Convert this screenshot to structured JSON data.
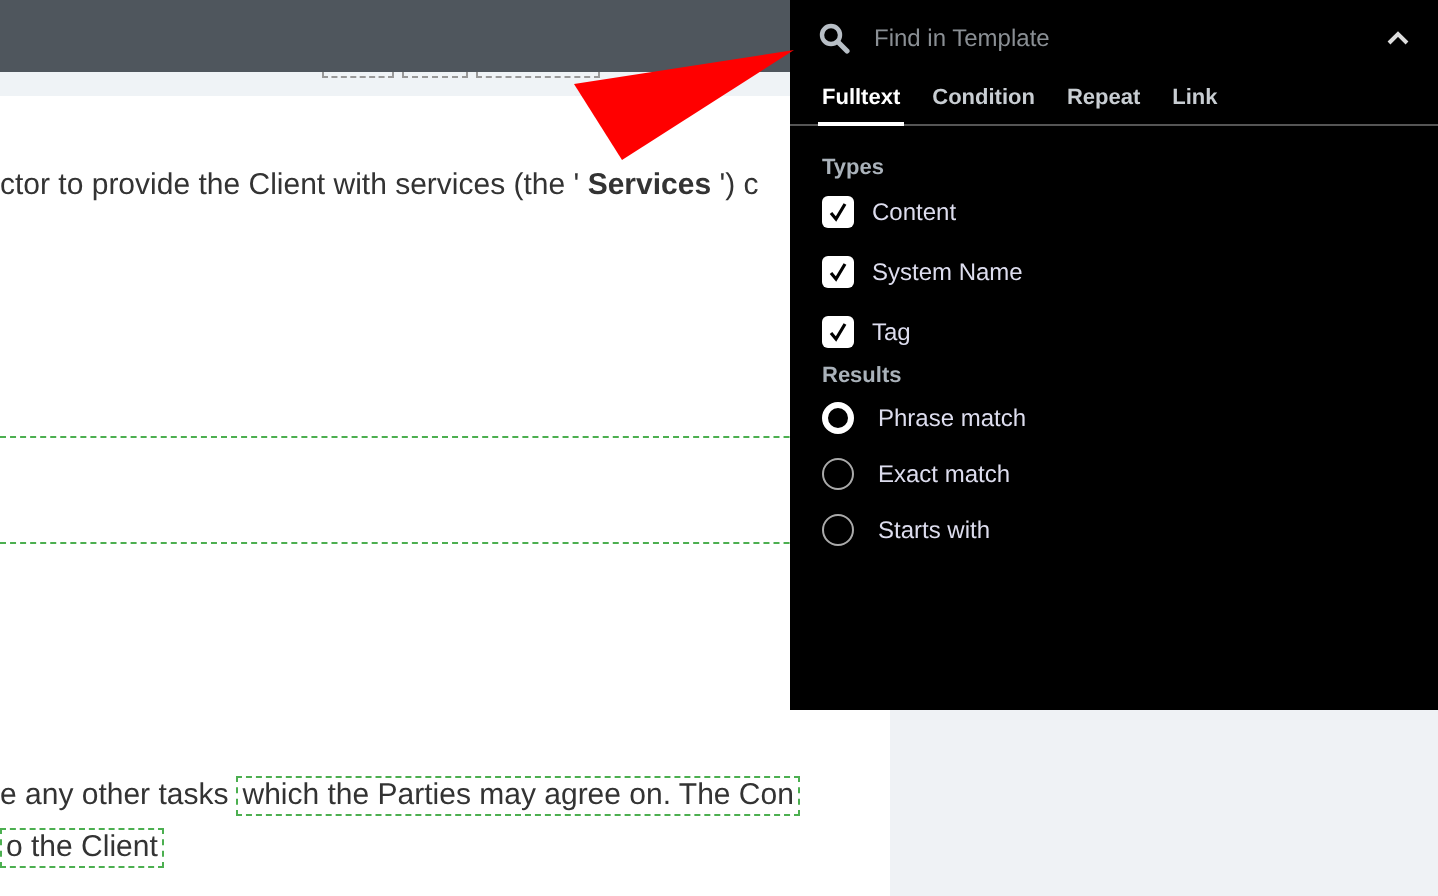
{
  "document": {
    "paragraph_1": "ctor to provide the Client with services (the ' **Services** ') c",
    "paragraph_2": {
      "text": "e any other tasks",
      "field": "which the Parties may agree on. The Con"
    },
    "paragraph_3": {
      "field": "o the Client"
    }
  },
  "search_panel": {
    "search": {
      "placeholder": "Find in Template"
    },
    "tabs": [
      {
        "label": "Fulltext",
        "selected": true
      },
      {
        "label": "Condition",
        "selected": false
      },
      {
        "label": "Repeat",
        "selected": false
      },
      {
        "label": "Link",
        "selected": false
      }
    ],
    "types_heading": "Types",
    "types": [
      {
        "label": "Content",
        "checked": true
      },
      {
        "label": "System Name",
        "checked": true
      },
      {
        "label": "Tag",
        "checked": true
      }
    ],
    "results_heading": "Results",
    "results": [
      {
        "label": "Phrase match",
        "selected": true
      },
      {
        "label": "Exact match",
        "selected": false
      },
      {
        "label": "Starts with",
        "selected": false
      }
    ]
  }
}
